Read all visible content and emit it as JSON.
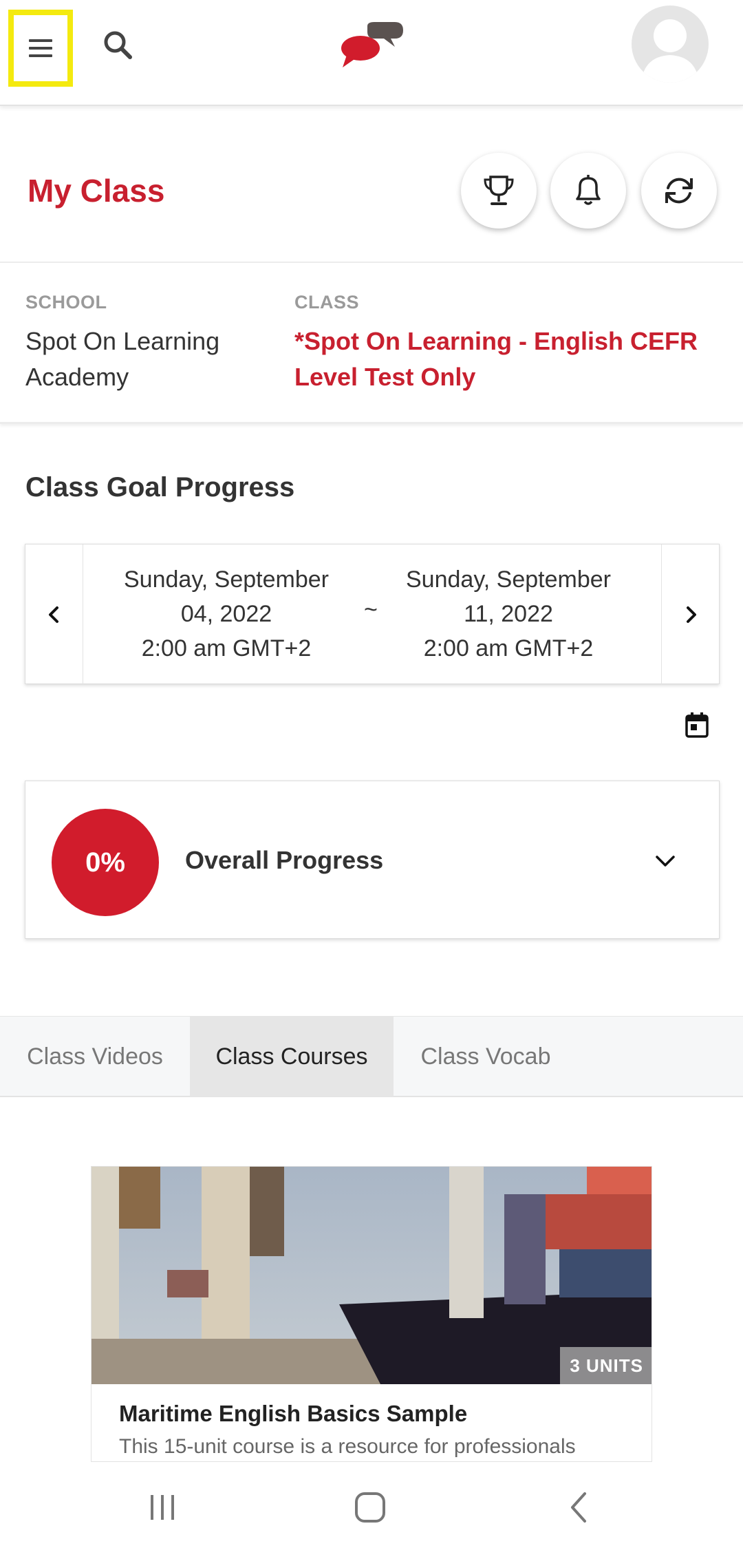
{
  "colors": {
    "brand_red": "#c8202f",
    "highlight_yellow": "#f4ea0f"
  },
  "header": {
    "menu_icon": "hamburger-menu-icon",
    "search_icon": "search-icon",
    "logo_icon": "chat-bubbles-logo",
    "avatar_icon": "user-avatar-icon"
  },
  "page": {
    "title": "My Class",
    "actions": [
      "trophy-icon",
      "bell-icon",
      "refresh-icon"
    ]
  },
  "info": {
    "school_label": "SCHOOL",
    "school_value": "Spot On Learning Academy",
    "class_label": "CLASS",
    "class_value": "*Spot On Learning - English CEFR Level Test Only"
  },
  "goal": {
    "title": "Class Goal Progress",
    "from_line1": "Sunday, September",
    "from_line2": "04, 2022",
    "from_line3": "2:00 am GMT+2",
    "separator": "~",
    "to_line1": "Sunday, September",
    "to_line2": "11, 2022",
    "to_line3": "2:00 am GMT+2"
  },
  "progress": {
    "percent_label": "0%",
    "percent_value": 0,
    "label": "Overall Progress"
  },
  "tabs": [
    {
      "label": "Class Videos",
      "active": false
    },
    {
      "label": "Class Courses",
      "active": true
    },
    {
      "label": "Class Vocab",
      "active": false
    }
  ],
  "course": {
    "units": "3 UNITS",
    "title": "Maritime English Basics Sample",
    "description": "This 15-unit course is a resource for professionals"
  },
  "system_nav": [
    "recent-apps-icon",
    "home-icon",
    "back-icon"
  ]
}
